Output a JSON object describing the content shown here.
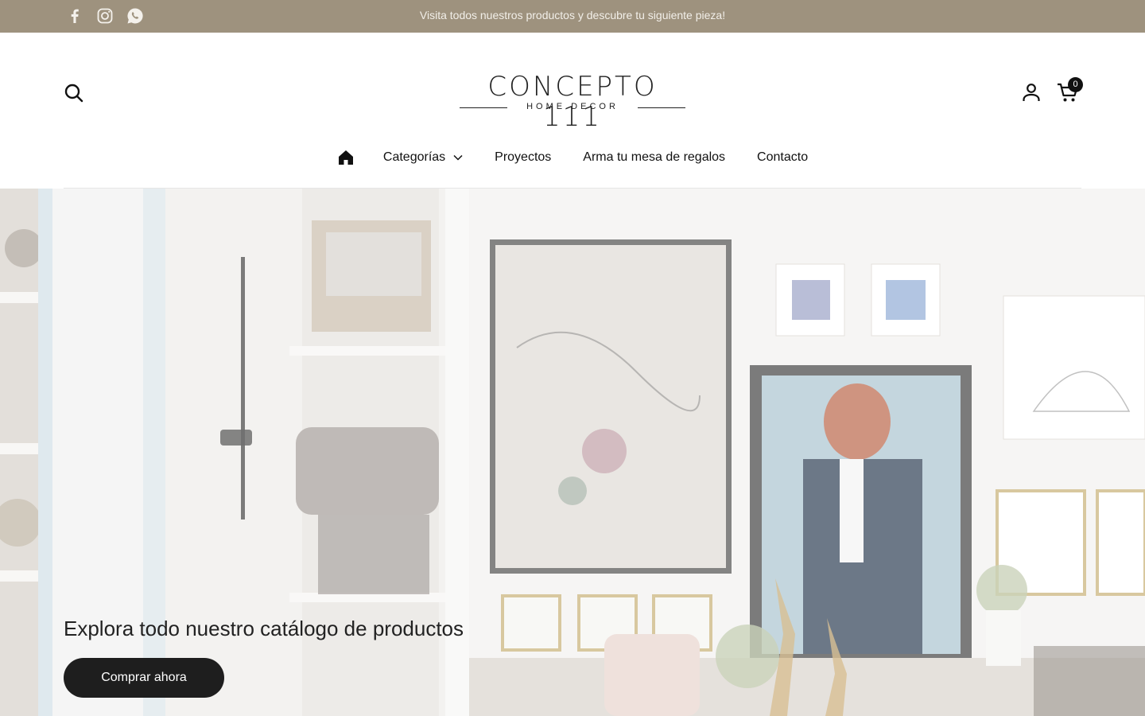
{
  "announcement": {
    "text": "Visita todos nuestros productos y descubre tu siguiente pieza!",
    "socials": [
      "facebook-icon",
      "instagram-icon",
      "whatsapp-icon"
    ]
  },
  "header": {
    "logo_title": "CONCEPTO 111",
    "logo_subtitle": "HOME DECOR",
    "cart_count": "0",
    "icons": [
      "search-icon",
      "account-icon",
      "cart-icon"
    ]
  },
  "nav": {
    "home_icon": "home-icon",
    "items": [
      "Categorías",
      "Proyectos",
      "Arma tu mesa de regalos",
      "Contacto"
    ]
  },
  "hero": {
    "title": "Explora todo nuestro catálogo de productos",
    "button": "Comprar ahora"
  },
  "colors": {
    "announcement_bg": "#9e927e",
    "button_bg": "#1e1e1e",
    "text": "#111111"
  }
}
